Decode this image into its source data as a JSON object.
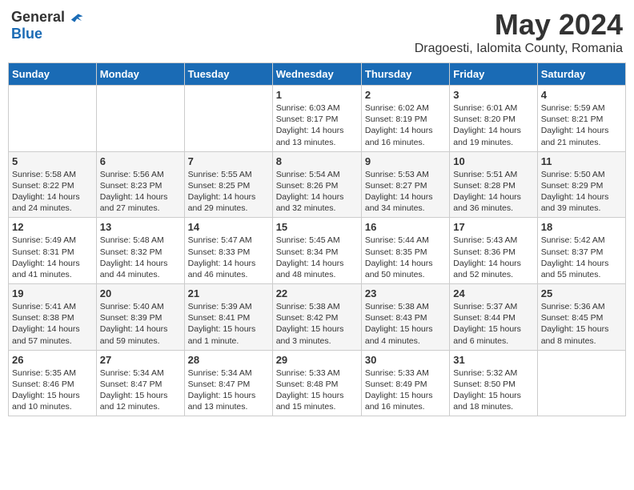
{
  "header": {
    "logo_general": "General",
    "logo_blue": "Blue",
    "month_title": "May 2024",
    "subtitle": "Dragoesti, Ialomita County, Romania"
  },
  "days_of_week": [
    "Sunday",
    "Monday",
    "Tuesday",
    "Wednesday",
    "Thursday",
    "Friday",
    "Saturday"
  ],
  "weeks": [
    [
      {
        "day": "",
        "info": ""
      },
      {
        "day": "",
        "info": ""
      },
      {
        "day": "",
        "info": ""
      },
      {
        "day": "1",
        "info": "Sunrise: 6:03 AM\nSunset: 8:17 PM\nDaylight: 14 hours\nand 13 minutes."
      },
      {
        "day": "2",
        "info": "Sunrise: 6:02 AM\nSunset: 8:19 PM\nDaylight: 14 hours\nand 16 minutes."
      },
      {
        "day": "3",
        "info": "Sunrise: 6:01 AM\nSunset: 8:20 PM\nDaylight: 14 hours\nand 19 minutes."
      },
      {
        "day": "4",
        "info": "Sunrise: 5:59 AM\nSunset: 8:21 PM\nDaylight: 14 hours\nand 21 minutes."
      }
    ],
    [
      {
        "day": "5",
        "info": "Sunrise: 5:58 AM\nSunset: 8:22 PM\nDaylight: 14 hours\nand 24 minutes."
      },
      {
        "day": "6",
        "info": "Sunrise: 5:56 AM\nSunset: 8:23 PM\nDaylight: 14 hours\nand 27 minutes."
      },
      {
        "day": "7",
        "info": "Sunrise: 5:55 AM\nSunset: 8:25 PM\nDaylight: 14 hours\nand 29 minutes."
      },
      {
        "day": "8",
        "info": "Sunrise: 5:54 AM\nSunset: 8:26 PM\nDaylight: 14 hours\nand 32 minutes."
      },
      {
        "day": "9",
        "info": "Sunrise: 5:53 AM\nSunset: 8:27 PM\nDaylight: 14 hours\nand 34 minutes."
      },
      {
        "day": "10",
        "info": "Sunrise: 5:51 AM\nSunset: 8:28 PM\nDaylight: 14 hours\nand 36 minutes."
      },
      {
        "day": "11",
        "info": "Sunrise: 5:50 AM\nSunset: 8:29 PM\nDaylight: 14 hours\nand 39 minutes."
      }
    ],
    [
      {
        "day": "12",
        "info": "Sunrise: 5:49 AM\nSunset: 8:31 PM\nDaylight: 14 hours\nand 41 minutes."
      },
      {
        "day": "13",
        "info": "Sunrise: 5:48 AM\nSunset: 8:32 PM\nDaylight: 14 hours\nand 44 minutes."
      },
      {
        "day": "14",
        "info": "Sunrise: 5:47 AM\nSunset: 8:33 PM\nDaylight: 14 hours\nand 46 minutes."
      },
      {
        "day": "15",
        "info": "Sunrise: 5:45 AM\nSunset: 8:34 PM\nDaylight: 14 hours\nand 48 minutes."
      },
      {
        "day": "16",
        "info": "Sunrise: 5:44 AM\nSunset: 8:35 PM\nDaylight: 14 hours\nand 50 minutes."
      },
      {
        "day": "17",
        "info": "Sunrise: 5:43 AM\nSunset: 8:36 PM\nDaylight: 14 hours\nand 52 minutes."
      },
      {
        "day": "18",
        "info": "Sunrise: 5:42 AM\nSunset: 8:37 PM\nDaylight: 14 hours\nand 55 minutes."
      }
    ],
    [
      {
        "day": "19",
        "info": "Sunrise: 5:41 AM\nSunset: 8:38 PM\nDaylight: 14 hours\nand 57 minutes."
      },
      {
        "day": "20",
        "info": "Sunrise: 5:40 AM\nSunset: 8:39 PM\nDaylight: 14 hours\nand 59 minutes."
      },
      {
        "day": "21",
        "info": "Sunrise: 5:39 AM\nSunset: 8:41 PM\nDaylight: 15 hours\nand 1 minute."
      },
      {
        "day": "22",
        "info": "Sunrise: 5:38 AM\nSunset: 8:42 PM\nDaylight: 15 hours\nand 3 minutes."
      },
      {
        "day": "23",
        "info": "Sunrise: 5:38 AM\nSunset: 8:43 PM\nDaylight: 15 hours\nand 4 minutes."
      },
      {
        "day": "24",
        "info": "Sunrise: 5:37 AM\nSunset: 8:44 PM\nDaylight: 15 hours\nand 6 minutes."
      },
      {
        "day": "25",
        "info": "Sunrise: 5:36 AM\nSunset: 8:45 PM\nDaylight: 15 hours\nand 8 minutes."
      }
    ],
    [
      {
        "day": "26",
        "info": "Sunrise: 5:35 AM\nSunset: 8:46 PM\nDaylight: 15 hours\nand 10 minutes."
      },
      {
        "day": "27",
        "info": "Sunrise: 5:34 AM\nSunset: 8:47 PM\nDaylight: 15 hours\nand 12 minutes."
      },
      {
        "day": "28",
        "info": "Sunrise: 5:34 AM\nSunset: 8:47 PM\nDaylight: 15 hours\nand 13 minutes."
      },
      {
        "day": "29",
        "info": "Sunrise: 5:33 AM\nSunset: 8:48 PM\nDaylight: 15 hours\nand 15 minutes."
      },
      {
        "day": "30",
        "info": "Sunrise: 5:33 AM\nSunset: 8:49 PM\nDaylight: 15 hours\nand 16 minutes."
      },
      {
        "day": "31",
        "info": "Sunrise: 5:32 AM\nSunset: 8:50 PM\nDaylight: 15 hours\nand 18 minutes."
      },
      {
        "day": "",
        "info": ""
      }
    ]
  ]
}
